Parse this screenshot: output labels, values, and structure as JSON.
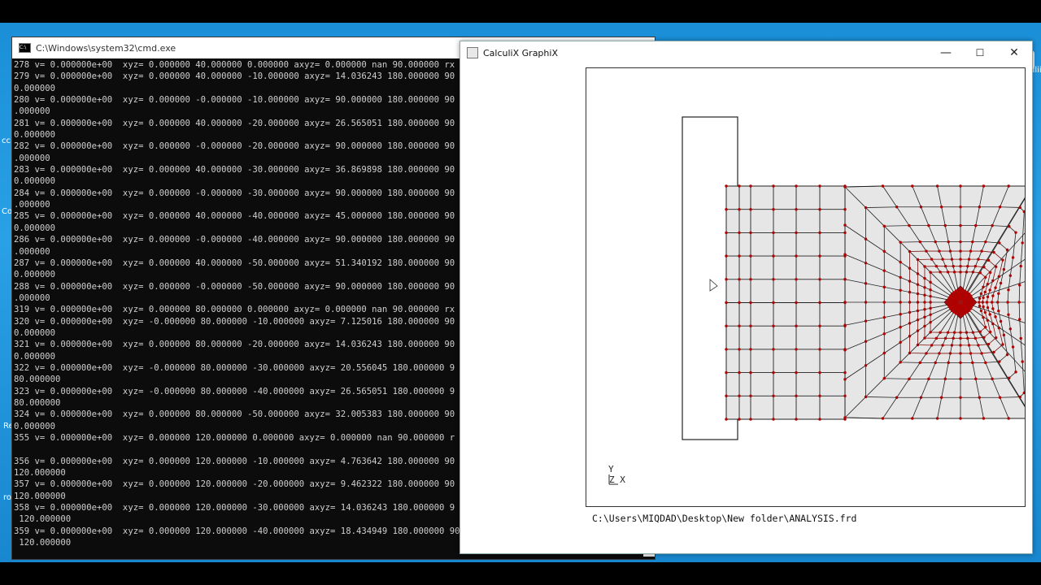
{
  "cmd": {
    "title": "C:\\Windows\\system32\\cmd.exe",
    "lines": [
      "278 v= 0.000000e+00  xyz= 0.000000 40.000000 0.000000 axyz= 0.000000 nan 90.000000 rx",
      "279 v= 0.000000e+00  xyz= 0.000000 40.000000 -10.000000 axyz= 14.036243 180.000000 90",
      "0.000000",
      "280 v= 0.000000e+00  xyz= 0.000000 -0.000000 -10.000000 axyz= 90.000000 180.000000 90",
      ".000000",
      "281 v= 0.000000e+00  xyz= 0.000000 40.000000 -20.000000 axyz= 26.565051 180.000000 90",
      "0.000000",
      "282 v= 0.000000e+00  xyz= 0.000000 -0.000000 -20.000000 axyz= 90.000000 180.000000 90",
      ".000000",
      "283 v= 0.000000e+00  xyz= 0.000000 40.000000 -30.000000 axyz= 36.869898 180.000000 90",
      "0.000000",
      "284 v= 0.000000e+00  xyz= 0.000000 -0.000000 -30.000000 axyz= 90.000000 180.000000 90",
      ".000000",
      "285 v= 0.000000e+00  xyz= 0.000000 40.000000 -40.000000 axyz= 45.000000 180.000000 90",
      "0.000000",
      "286 v= 0.000000e+00  xyz= 0.000000 -0.000000 -40.000000 axyz= 90.000000 180.000000 90",
      ".000000",
      "287 v= 0.000000e+00  xyz= 0.000000 40.000000 -50.000000 axyz= 51.340192 180.000000 90",
      "0.000000",
      "288 v= 0.000000e+00  xyz= 0.000000 -0.000000 -50.000000 axyz= 90.000000 180.000000 90",
      ".000000",
      "319 v= 0.000000e+00  xyz= 0.000000 80.000000 0.000000 axyz= 0.000000 nan 90.000000 rx",
      "320 v= 0.000000e+00  xyz= -0.000000 80.000000 -10.000000 axyz= 7.125016 180.000000 90",
      "0.000000",
      "321 v= 0.000000e+00  xyz= 0.000000 80.000000 -20.000000 axyz= 14.036243 180.000000 90",
      "0.000000",
      "322 v= 0.000000e+00  xyz= -0.000000 80.000000 -30.000000 axyz= 20.556045 180.000000 9",
      "80.000000",
      "323 v= 0.000000e+00  xyz= -0.000000 80.000000 -40.000000 axyz= 26.565051 180.000000 9",
      "80.000000",
      "324 v= 0.000000e+00  xyz= 0.000000 80.000000 -50.000000 axyz= 32.005383 180.000000 90",
      "0.000000",
      "355 v= 0.000000e+00  xyz= 0.000000 120.000000 0.000000 axyz= 0.000000 nan 90.000000 r",
      "",
      "356 v= 0.000000e+00  xyz= 0.000000 120.000000 -10.000000 axyz= 4.763642 180.000000 90",
      "120.000000",
      "357 v= 0.000000e+00  xyz= 0.000000 120.000000 -20.000000 axyz= 9.462322 180.000000 90",
      "120.000000",
      "358 v= 0.000000e+00  xyz= 0.000000 120.000000 -30.000000 axyz= 14.036243 180.000000 9",
      " 120.000000",
      "359 v= 0.000000e+00  xyz= 0.000000 120.000000 -40.000000 axyz= 18.434949 180.000000 90",
      " 120.000000"
    ]
  },
  "graphix": {
    "title": "CalculiX GraphiX",
    "minimize": "—",
    "maximize": "☐",
    "close": "✕",
    "axis_y": "Y",
    "axis_x": "Z X",
    "file_path": "C:\\Users\\MIQDAD\\Desktop\\New folder\\ANALYSIS.frd"
  },
  "desktop": {
    "edge_labels": [
      "cc",
      "Co",
      "Re",
      "ro"
    ],
    "right_label": "ulii"
  },
  "colors": {
    "mesh_fill": "#e6e6e6",
    "mesh_line": "#222222",
    "node": "#b00000"
  }
}
